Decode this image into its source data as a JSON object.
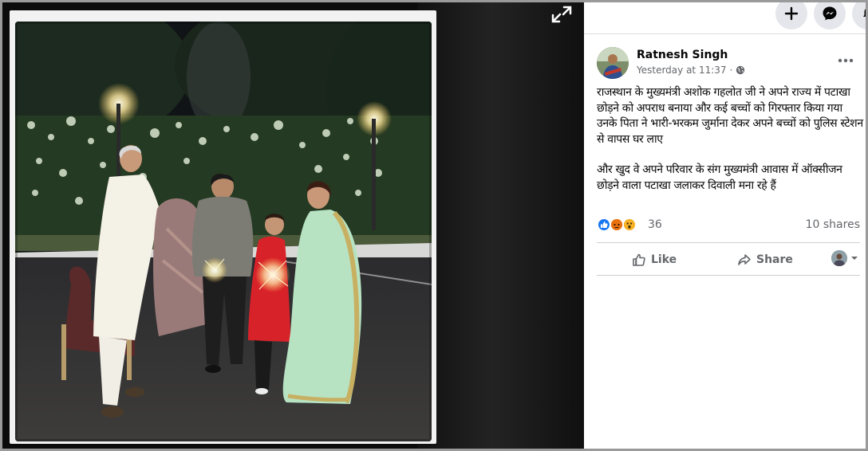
{
  "viewer": {
    "expand_icon": "expand-icon",
    "photo_description_icon": "photo"
  },
  "topbar": {
    "buttons": [
      {
        "icon": "plus-icon"
      },
      {
        "icon": "messenger-icon"
      },
      {
        "icon": "notifications-icon"
      }
    ]
  },
  "post": {
    "author": "Ratnesh Singh",
    "time": "Yesterday at 11:37",
    "separator": "·",
    "privacy_icon": "globe-icon",
    "more_icon": "more-options-icon",
    "paragraphs": [
      "राजस्थान के मुख्यमंत्री अशोक गहलोत जी ने अपने राज्य में पटाखा छोड़ने को अपराध बनाया और कई बच्चों को गिरफ्तार किया गया उनके पिता ने भारी-भरकम जुर्माना देकर अपने बच्चों को पुलिस स्टेशन से वापस घर लाए",
      "और खुद वे अपने परिवार के संग मुख्यमंत्री आवास में ऑक्सीजन छोड़ने वाला पटाखा जलाकर दिवाली मना रहे हैं"
    ],
    "reactions": {
      "types": [
        "like",
        "angry",
        "wow"
      ],
      "colors": {
        "like": "#1877f2",
        "angry": "#e9710f",
        "wow": "#f7b125"
      },
      "count": "36"
    },
    "shares": "10 shares",
    "actions": {
      "like_label": "Like",
      "share_label": "Share"
    }
  }
}
